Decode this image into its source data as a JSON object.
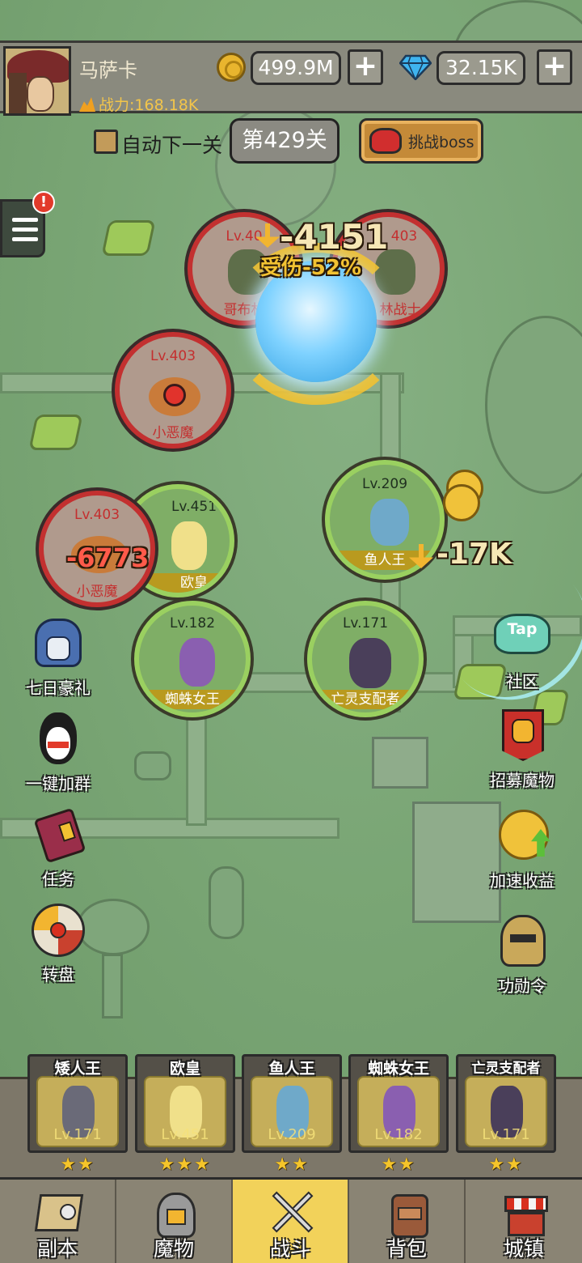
{
  "player": {
    "name": "马萨卡",
    "power": "战力:168.18K"
  },
  "resources": {
    "gold": "499.9M",
    "gems": "32.15K",
    "plus": "+"
  },
  "stage": {
    "auto_label": "自动下一关",
    "current": "第429关",
    "boss_label": "挑战boss"
  },
  "menu": {
    "alert": "!"
  },
  "enemies": [
    {
      "level": "Lv.403",
      "name": "哥布林战士"
    },
    {
      "level": "Lv.403",
      "name": "哥布林战士"
    },
    {
      "level": "Lv.403",
      "name": "小恶魔"
    },
    {
      "level": "Lv.403",
      "name": "小恶魔"
    }
  ],
  "enemy_labels": {
    "left_goblin_level": "Lv.40",
    "left_goblin_name": "哥布林",
    "right_goblin_level": "403",
    "right_goblin_name": "林战士"
  },
  "allies": [
    {
      "level": "Lv.451",
      "name": "欧皇"
    },
    {
      "level": "Lv.209",
      "name": "鱼人王"
    },
    {
      "level": "Lv.182",
      "name": "蜘蛛女王"
    },
    {
      "level": "Lv.171",
      "name": "亡灵支配者"
    }
  ],
  "combat": {
    "damage_main": "-4151",
    "damage_taken": "受伤-52%",
    "damage_imp": "-6773",
    "damage_fish": "-17K"
  },
  "features_left": [
    {
      "label": "七日豪礼",
      "icon": "knight-helmet-icon"
    },
    {
      "label": "一键加群",
      "icon": "penguin-icon"
    },
    {
      "label": "任务",
      "icon": "quest-book-icon"
    },
    {
      "label": "转盘",
      "icon": "wheel-icon"
    }
  ],
  "features_right": [
    {
      "label": "社区",
      "icon": "tap-icon",
      "badge": "Tap"
    },
    {
      "label": "招募魔物",
      "icon": "banner-icon"
    },
    {
      "label": "加速收益",
      "icon": "coin-boost-icon"
    },
    {
      "label": "功勋令",
      "icon": "helmet-icon"
    }
  ],
  "team": [
    {
      "name": "矮人王",
      "level": "Lv.171",
      "stars": "★★"
    },
    {
      "name": "欧皇",
      "level": "Lv.451",
      "stars": "★★★"
    },
    {
      "name": "鱼人王",
      "level": "Lv.209",
      "stars": "★★"
    },
    {
      "name": "蜘蛛女王",
      "level": "Lv.182",
      "stars": "★★"
    },
    {
      "name": "亡灵支配者",
      "level": "Lv.171",
      "stars": "★★"
    }
  ],
  "nav": [
    {
      "label": "副本",
      "icon": "map-icon"
    },
    {
      "label": "魔物",
      "icon": "monster-helmet-icon"
    },
    {
      "label": "战斗",
      "icon": "crossed-swords-icon",
      "active": true
    },
    {
      "label": "背包",
      "icon": "backpack-icon"
    },
    {
      "label": "城镇",
      "icon": "shop-icon"
    }
  ],
  "colors": {
    "accent_gold": "#f2d25a",
    "enemy_red": "#c33030",
    "ally_green": "#9ad060",
    "map_green": "#7aa576"
  }
}
